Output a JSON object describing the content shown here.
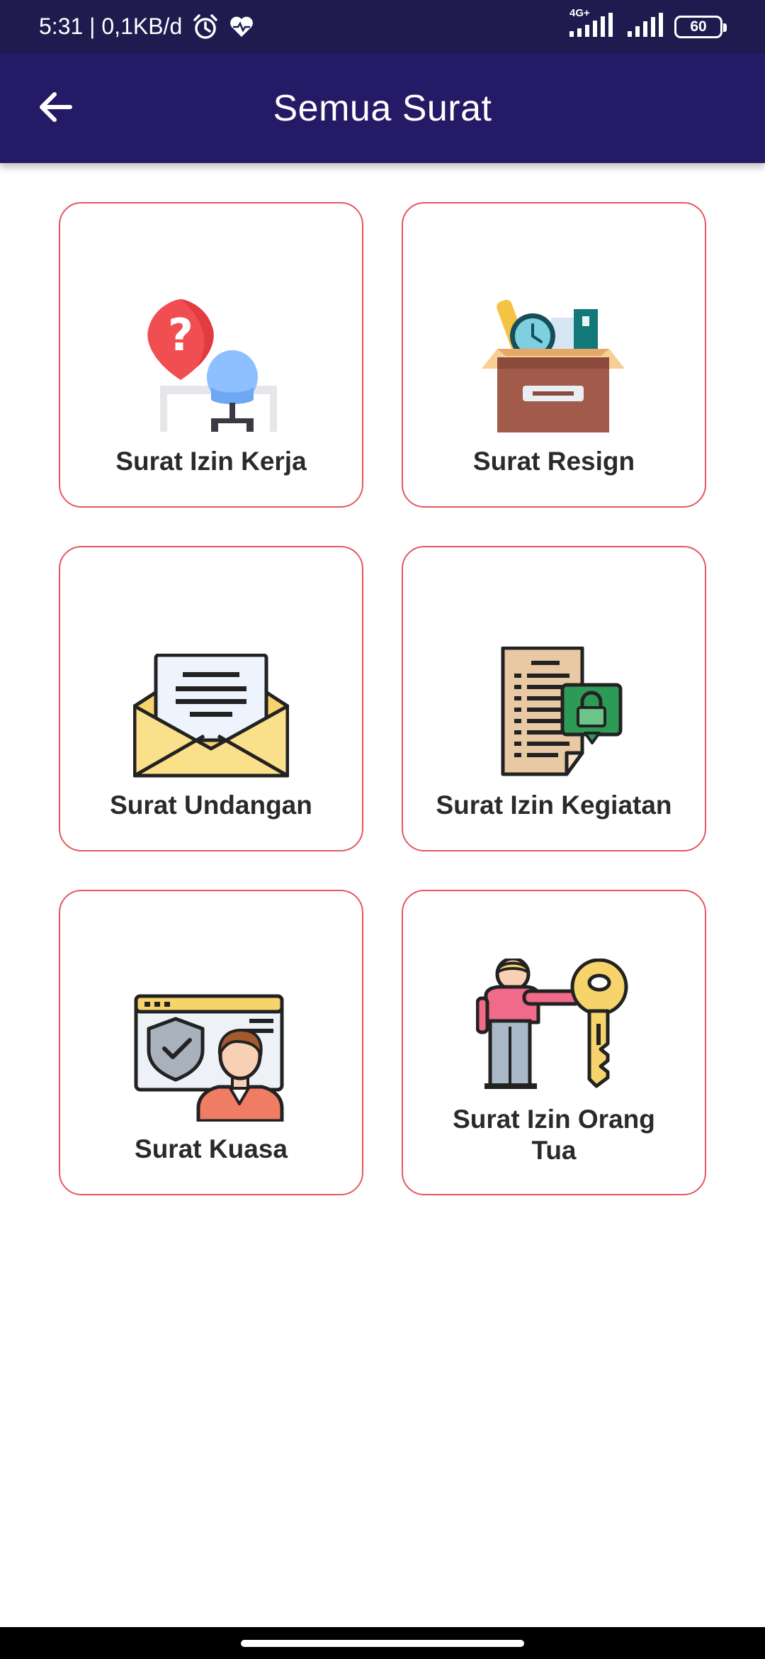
{
  "status_bar": {
    "time_and_speed": "5:31 | 0,1KB/d",
    "network": "4G+",
    "battery": "60",
    "icons": [
      "alarm-icon",
      "health-icon",
      "signal-icon",
      "signal-icon",
      "battery-icon"
    ]
  },
  "app_bar": {
    "title": "Semua Surat",
    "back_icon": "arrow-left-icon",
    "background": "#251a66"
  },
  "cards": [
    {
      "label": "Surat Izin Kerja",
      "icon": "office-chair-question-icon"
    },
    {
      "label": "Surat Resign",
      "icon": "moving-box-icon"
    },
    {
      "label": "Surat Undangan",
      "icon": "envelope-letter-icon"
    },
    {
      "label": "Surat Izin Kegiatan",
      "icon": "locked-document-icon"
    },
    {
      "label": "Surat Kuasa",
      "icon": "authorized-person-icon"
    },
    {
      "label": "Surat Izin Orang Tua",
      "icon": "person-key-icon"
    }
  ],
  "colors": {
    "card_border": "#e4575f",
    "status_bar": "#1f1b4e"
  }
}
